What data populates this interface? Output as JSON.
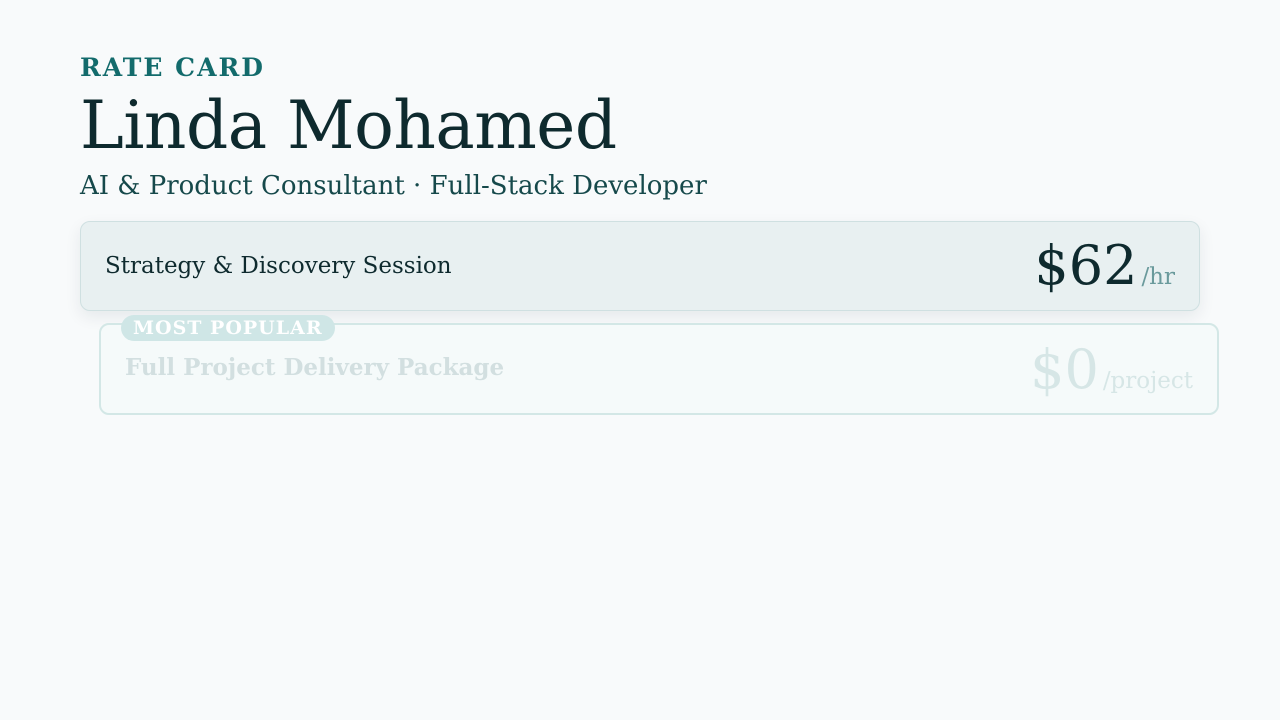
{
  "header": {
    "eyebrow": "RATE CARD",
    "name": "Linda Mohamed",
    "subtitle": "AI & Product Consultant · Full-Stack Developer"
  },
  "services": [
    {
      "title": "Strategy & Discovery Session",
      "price": "$62",
      "unit": "/hr"
    },
    {
      "badge": "MOST POPULAR",
      "title": "Full Project Delivery Package",
      "price": "$0",
      "unit": "/project"
    }
  ],
  "colors": {
    "accent": "#136b6c",
    "ink": "#0e2a2e",
    "background": "#f8fafb"
  }
}
